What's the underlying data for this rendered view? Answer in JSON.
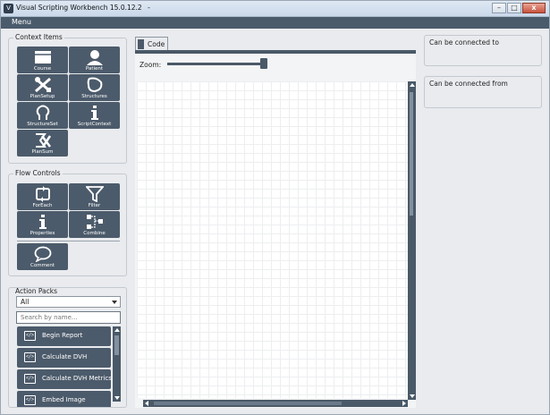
{
  "window": {
    "title": "Visual Scripting Workbench 15.0.12.2",
    "title_suffix": "-",
    "app_icon": "V"
  },
  "window_controls": {
    "minimize": "–",
    "maximize": "□",
    "close": "x"
  },
  "menu": {
    "label": "Menu"
  },
  "context_items": {
    "title": "Context Items",
    "tiles": [
      {
        "label": "Course",
        "icon": "window-icon"
      },
      {
        "label": "Patient",
        "icon": "person-icon"
      },
      {
        "label": "PlanSetup",
        "icon": "crossed-tools-icon"
      },
      {
        "label": "Structures",
        "icon": "blob-icon"
      },
      {
        "label": "StructureSet",
        "icon": "head-outline-icon"
      },
      {
        "label": "ScriptContext",
        "icon": "info-icon"
      },
      {
        "label": "PlanSum",
        "icon": "sigma-tools-icon"
      }
    ]
  },
  "flow_controls": {
    "title": "Flow Controls",
    "tiles": [
      {
        "label": "ForEach",
        "icon": "loop-icon"
      },
      {
        "label": "Filter",
        "icon": "funnel-icon"
      },
      {
        "label": "Properties",
        "icon": "info-icon"
      },
      {
        "label": "Combine",
        "icon": "combine-icon"
      },
      {
        "label": "Comment",
        "icon": "speech-bubble-icon"
      }
    ]
  },
  "action_packs": {
    "title": "Action Packs",
    "filter_value": "All",
    "search_placeholder": "Search by name...",
    "items": [
      {
        "label": "Begin Report"
      },
      {
        "label": "Calculate DVH"
      },
      {
        "label": "Calculate DVH Metrics"
      },
      {
        "label": "Embed Image"
      }
    ],
    "item_icon_glyph": "</>"
  },
  "code_panel": {
    "tab_label": "Code",
    "zoom_label": "Zoom:"
  },
  "right_panels": {
    "connected_to": "Can be connected to",
    "connected_from": "Can be connected from"
  },
  "colors": {
    "tile": "#4c5b6b",
    "menubar": "#4a5b6c",
    "background": "#e9ebee"
  }
}
